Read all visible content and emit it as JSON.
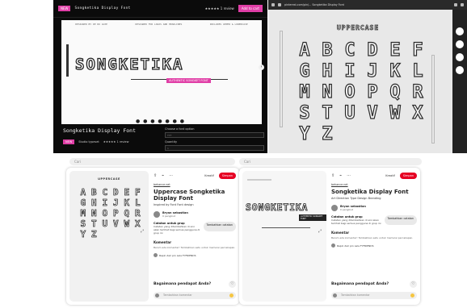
{
  "shop": {
    "tag": "NEW",
    "title": "Songketika Display Font",
    "rating": "★★★★★ 1 review",
    "cta": "Add to cart",
    "meta": [
      "DESIGNED BY DE RO LUXE",
      "DESIGNED FOR LOGOS AND HEADLINES",
      "INCLUDES UPPER & LOWERCASE"
    ],
    "preview_word": "SONGKETIKA",
    "preview_sub": "AUTHENTIC SONGKET FONT",
    "product_name": "Songketika Display Font",
    "badge": "NEW",
    "seller": "Studio typeset",
    "stars": "★★★★★ 1 review",
    "form_label_1": "Choose a font option",
    "form_value_1": "TTF",
    "form_label_2": "Quantity",
    "form_value_2": "1",
    "dots": "● ● ● ● ● ● ●"
  },
  "sheet": {
    "url": "pinterest.com/pin/... Songketika Display Font",
    "heading": "UPPERCASE",
    "letters": [
      "A",
      "B",
      "C",
      "D",
      "E",
      "F",
      "G",
      "H",
      "I",
      "J",
      "K",
      "L",
      "M",
      "N",
      "O",
      "P",
      "Q",
      "R",
      "S",
      "T",
      "U",
      "V",
      "W",
      "X",
      "Y",
      "Z"
    ]
  },
  "search": {
    "left": "Cari",
    "right": "Cari"
  },
  "pin1": {
    "image_heading": "UPPERCASE",
    "letters": [
      "A",
      "B",
      "C",
      "D",
      "E",
      "F",
      "G",
      "H",
      "I",
      "J",
      "K",
      "L",
      "M",
      "N",
      "O",
      "P",
      "Q",
      "R",
      "S",
      "T",
      "U",
      "V",
      "W",
      "X",
      "Y",
      "Z"
    ],
    "board": "Kreatif",
    "save": "Simpan",
    "link": "behance.net",
    "title": "Uppercase Songketika Display Font",
    "desc": "Inspired by Font Font design",
    "user_name": "Bryan sebastian",
    "user_followers": "0 pengikut",
    "note_title": "Catatan untuk grup",
    "note_text": "Catatan yang ditambahkan di sini akan terlihat bagi semua pengguna di grup ini",
    "note_button": "Tambahkan catatan",
    "comments_title": "Komentar",
    "comments_text": "Belum ada komentar! Tambahkan satu untuk memulai percakapan.",
    "repin_text": "Repin dari pin Lala FYFRIENDS",
    "question": "Bagaimana pendapat Anda?",
    "add_comment": "Tambahkan komentar"
  },
  "pin2": {
    "image_word": "SONGKETIKA",
    "image_sub": "AUTHENTIC SONGKET FONT",
    "board": "Kreatif",
    "save": "Simpan",
    "link": "behance.net",
    "title": "Songketika Display Font",
    "desc": "Art Direction Type Design Branding",
    "user_name": "Bryan sebastian",
    "user_followers": "0 pengikut",
    "note_title": "Catatan untuk grup",
    "note_text": "Catatan yang ditambahkan di sini akan terlihat bagi semua pengguna di grup ini",
    "note_button": "Tambahkan catatan",
    "comments_title": "Komentar",
    "comments_text": "Belum ada komentar! Tambahkan satu untuk memulai percakapan.",
    "repin_text": "Repin dari pin Lala FYFRIENDS",
    "question": "Bagaimana pendapat Anda?",
    "add_comment": "Tambahkan komentar"
  },
  "colors": {
    "accent_pink": "#e03ea6",
    "pinterest_red": "#e60023"
  }
}
